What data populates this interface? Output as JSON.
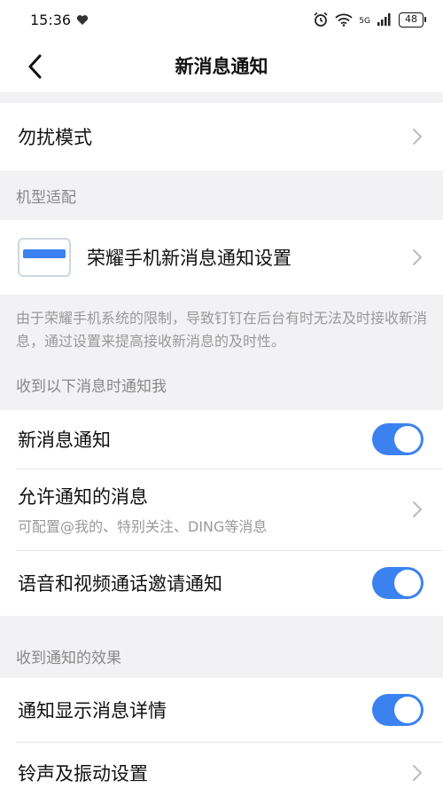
{
  "status_bar": {
    "time": "15:36",
    "network": "5G",
    "battery": "48"
  },
  "header": {
    "title": "新消息通知"
  },
  "dnd": {
    "label": "勿扰模式"
  },
  "device_section": {
    "header": "机型适配",
    "item_label": "荣耀手机新消息通知设置",
    "note": "由于荣耀手机系统的限制，导致钉钉在后台有时无法及时接收新消息，通过设置来提高接收新消息的及时性。"
  },
  "notify_section": {
    "header": "收到以下消息时通知我",
    "new_message_label": "新消息通知",
    "new_message_on": true,
    "allowed_label": "允许通知的消息",
    "allowed_sub": "可配置@我的、特别关注、DING等消息",
    "call_invite_label": "语音和视频通话邀请通知",
    "call_invite_on": true
  },
  "effect_section": {
    "header": "收到通知的效果",
    "show_details_label": "通知显示消息详情",
    "show_details_on": true,
    "ring_label": "铃声及振动设置"
  },
  "colors": {
    "accent": "#3b82f0",
    "background": "#f2f2f4"
  }
}
